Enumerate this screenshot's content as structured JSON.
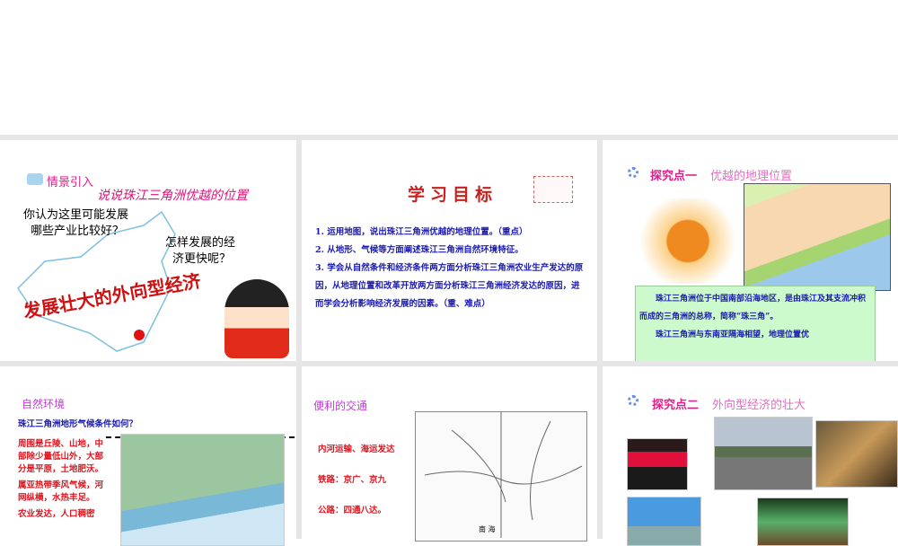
{
  "slides": [
    {
      "label": "情景引入",
      "title": "说说珠江三角洲优越的位置",
      "q1a": "你认为这里可能发展",
      "q1b": "哪些产业比较好？",
      "q2a": "怎样发展的经",
      "q2b": "济更快呢？",
      "slogan": "发展壮大的外向型经济"
    },
    {
      "title": "学习目标",
      "items": [
        "1. 运用地图，说出珠江三角洲优越的地理位置。（重点）",
        "2. 从地形、气候等方面阐述珠江三角洲自然环境特征。",
        "3. 学会从自然条件和经济条件两方面分析珠江三角洲农业生产发达的原因，从地理位置和改革开放两方面分析珠江三角洲经济发达的原因，进而学会分析影响经济发展的因素。（重、难点）"
      ]
    },
    {
      "label": "探究点一",
      "title": "优越的地理位置",
      "p1": "珠江三角洲位于中国南部沿海地区，是由珠江及其支流冲积而成的三角洲的总称，简称“珠三角”。",
      "p2": "珠江三角洲与东南亚隔海相望，地理位置优"
    },
    {
      "title": "自然环境",
      "question": "珠江三角洲地形气候条件如何？",
      "p1": "周围是丘陵、山地，中部除少量低山外，大部分是平原，土地肥沃。",
      "p2": "属亚热带季风气候，河网纵横，水热丰足。",
      "p3": "农业发达，人口稠密"
    },
    {
      "title": "便利的交通",
      "l1": "内河运输、海运发达",
      "l2": "铁路：京广、京九",
      "l3": "公路：四通八达。",
      "map_sea": "南    海"
    },
    {
      "label": "探究点二",
      "title": "外向型经济的壮大"
    }
  ]
}
